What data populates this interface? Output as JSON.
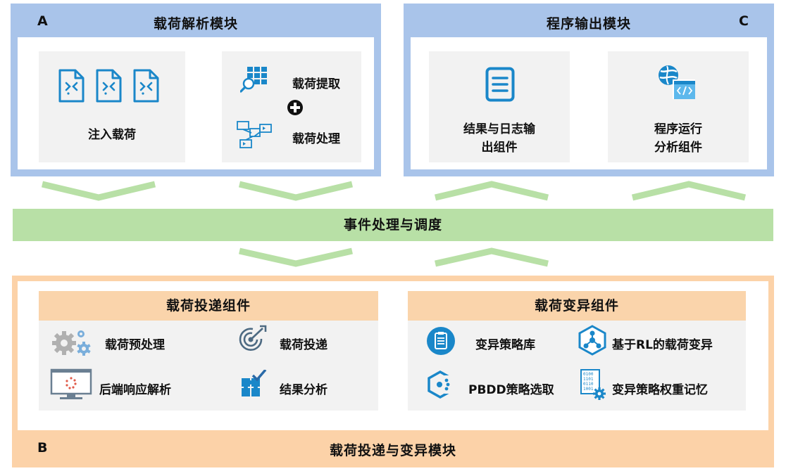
{
  "module_a": {
    "letter": "A",
    "title": "载荷解析模块",
    "inject_label": "注入载荷",
    "extract_label": "载荷提取",
    "process_label": "载荷处理"
  },
  "module_c": {
    "letter": "C",
    "title": "程序输出模块",
    "log_label_line1": "结果与日志输",
    "log_label_line2": "出组件",
    "runtime_label_line1": "程序运行",
    "runtime_label_line2": "分析组件"
  },
  "center": {
    "title": "事件处理与调度"
  },
  "module_b": {
    "letter": "B",
    "title": "载荷投递与变异模块",
    "delivery": {
      "title": "载荷投递组件",
      "items": [
        "载荷预处理",
        "载荷投递",
        "后端响应解析",
        "结果分析"
      ]
    },
    "mutation": {
      "title": "载荷变异组件",
      "items": [
        "变异策略库",
        "基于RL的载荷变异",
        "PBDD策略选取",
        "变异策略权重记忆"
      ]
    }
  },
  "colors": {
    "blue_frame": "#a9c4ea",
    "green_band": "#b8e0a6",
    "orange_frame": "#fcd2a8",
    "icon_blue": "#1a87c9"
  }
}
